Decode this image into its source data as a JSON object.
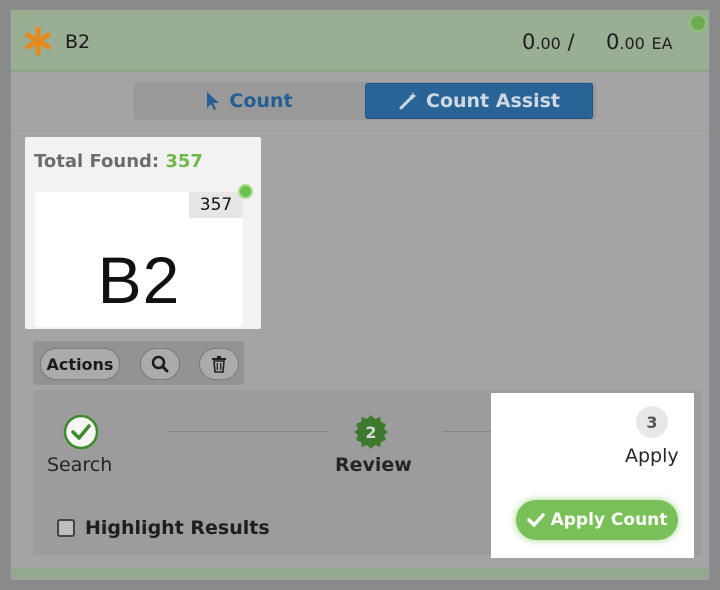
{
  "header": {
    "item_name": "B2",
    "qty_counted_int": "0",
    "qty_counted_dec": ".00",
    "separator": "/",
    "qty_total_int": "0",
    "qty_total_dec": ".00",
    "unit": "EA"
  },
  "mode_tabs": [
    {
      "label": "Count",
      "icon": "cursor-icon",
      "active": false
    },
    {
      "label": "Count Assist",
      "icon": "magic-wand-icon",
      "active": true
    }
  ],
  "results": {
    "total_found_label": "Total Found:",
    "total_found_value": "357",
    "thumbnail_label": "B2",
    "thumbnail_count": "357",
    "actions_label": "Actions"
  },
  "steps": [
    {
      "label": "Search",
      "state": "complete"
    },
    {
      "label": "Review",
      "number": "2",
      "state": "current"
    },
    {
      "label": "Apply",
      "number": "3",
      "state": "upcoming"
    }
  ],
  "options": {
    "highlight_label": "Highlight Results",
    "highlight_checked": false
  },
  "apply_button_label": "Apply Count",
  "colors": {
    "accent_blue": "#2a6496",
    "success_green": "#78c057",
    "asterisk_orange": "#e58a1f"
  }
}
